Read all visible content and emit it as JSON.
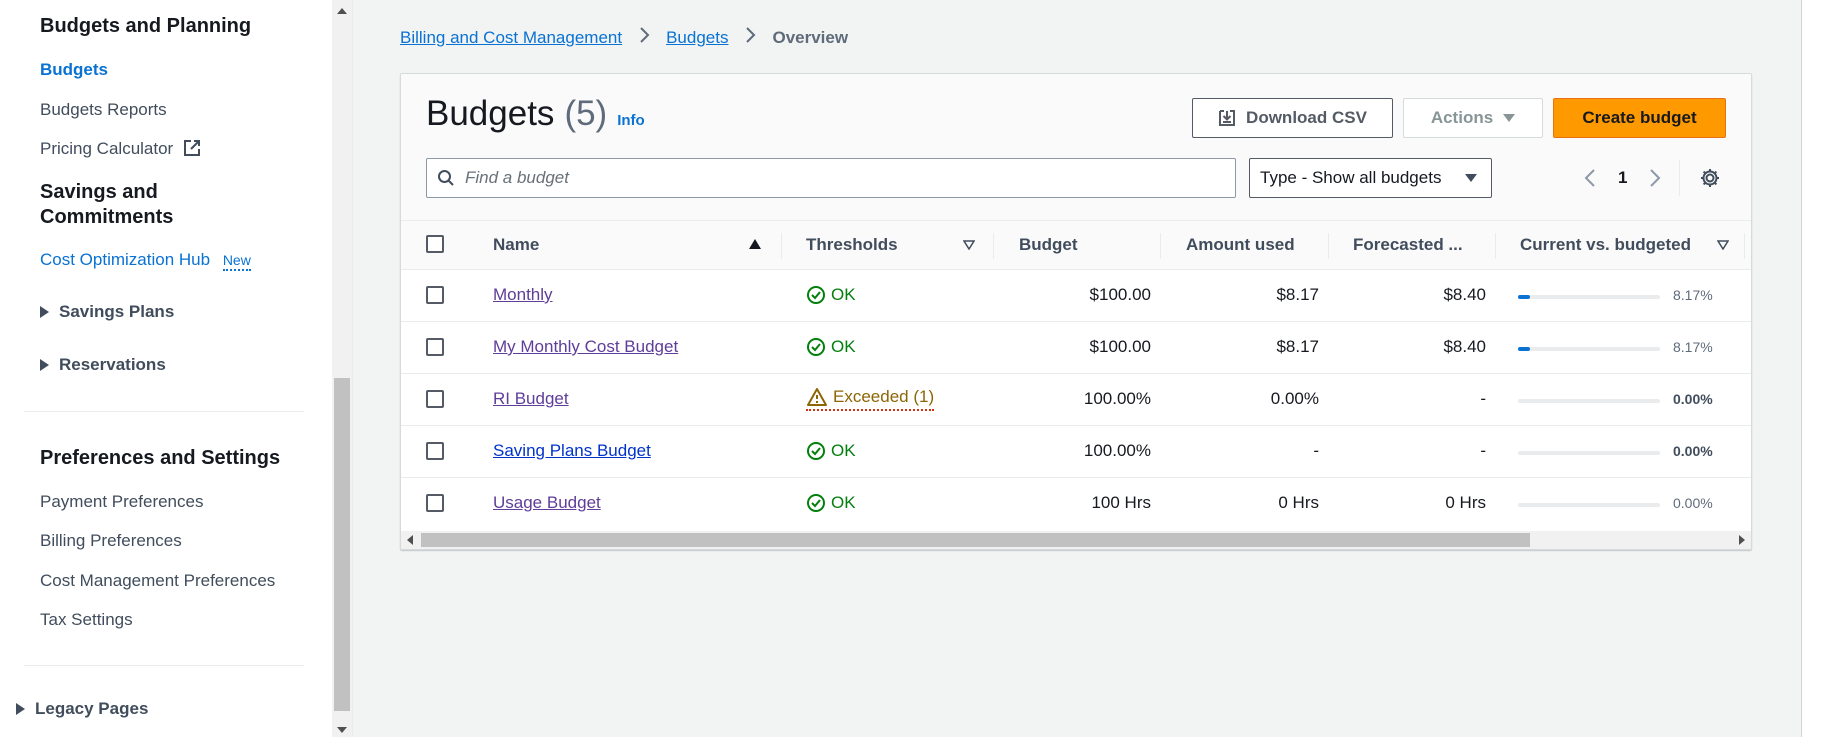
{
  "sidebar": {
    "section1_heading": "Budgets and Planning",
    "budgets": "Budgets",
    "budgets_reports": "Budgets Reports",
    "pricing_calculator": "Pricing Calculator",
    "section2_heading_line1": "Savings and",
    "section2_heading_line2": "Commitments",
    "cost_optimization_hub": "Cost Optimization Hub",
    "new_badge": "New",
    "savings_plans": "Savings Plans",
    "reservations": "Reservations",
    "section3_heading": "Preferences and Settings",
    "payment_preferences": "Payment Preferences",
    "billing_preferences": "Billing Preferences",
    "cost_management_preferences": "Cost Management Preferences",
    "tax_settings": "Tax Settings",
    "legacy_pages": "Legacy Pages"
  },
  "breadcrumb": {
    "item1": "Billing and Cost Management",
    "item2": "Budgets",
    "current": "Overview"
  },
  "header": {
    "title": "Budgets",
    "count": "(5)",
    "info": "Info",
    "download_csv": "Download CSV",
    "actions": "Actions",
    "create_budget": "Create budget"
  },
  "filters": {
    "search_placeholder": "Find a budget",
    "type_select": "Type - Show all budgets",
    "page": "1"
  },
  "table": {
    "columns": {
      "name": "Name",
      "thresholds": "Thresholds",
      "budget": "Budget",
      "amount_used": "Amount used",
      "forecasted": "Forecasted ...",
      "current_vs_budgeted": "Current vs. budgeted"
    },
    "rows": [
      {
        "name": "Monthly",
        "threshold": "OK",
        "budget": "$100.00",
        "amount_used": "$8.17",
        "forecasted": "$8.40",
        "pct": "8.17%",
        "progress": 0.0817
      },
      {
        "name": "My Monthly Cost Budget",
        "threshold": "OK",
        "budget": "$100.00",
        "amount_used": "$8.17",
        "forecasted": "$8.40",
        "pct": "8.17%",
        "progress": 0.0817
      },
      {
        "name": "RI Budget",
        "threshold": "Exceeded (1)",
        "budget": "100.00%",
        "amount_used": "0.00%",
        "forecasted": "-",
        "pct": "0.00%",
        "progress": 0
      },
      {
        "name": "Saving Plans Budget",
        "threshold": "OK",
        "budget": "100.00%",
        "amount_used": "-",
        "forecasted": "-",
        "pct": "0.00%",
        "progress": 0
      },
      {
        "name": "Usage Budget",
        "threshold": "OK",
        "budget": "100 Hrs",
        "amount_used": "0 Hrs",
        "forecasted": "0 Hrs",
        "pct": "0.00%",
        "progress": 0
      }
    ]
  },
  "colors": {
    "link_blue": "#0972d3",
    "visited_purple": "#5f3d98",
    "ok_green": "#037f0c",
    "warn_amber": "#8d6605",
    "primary_orange": "#ff9900"
  }
}
